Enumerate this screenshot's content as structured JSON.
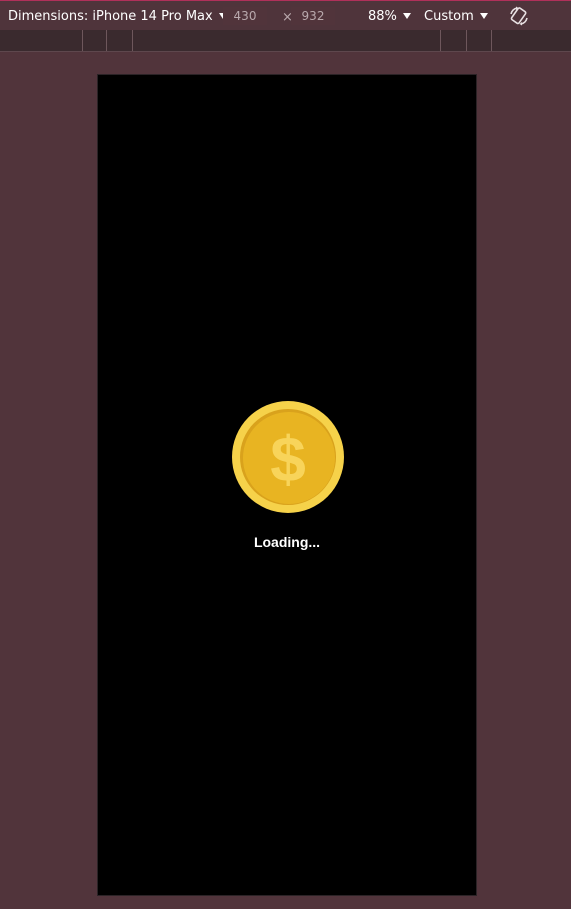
{
  "toolbar": {
    "dimensions_label": "Dimensions: iPhone 14 Pro Max",
    "width_value": "430",
    "times_symbol": "×",
    "height_value": "932",
    "zoom_value": "88%",
    "throttle_value": "Custom",
    "rotate_icon": "rotate-device-icon"
  },
  "screen": {
    "coin_icon": "dollar-coin-icon",
    "loading_text": "Loading..."
  },
  "colors": {
    "page_background": "#51343b",
    "screen_background": "#000000",
    "coin_outer": "#f6d24a",
    "coin_inner": "#e8b422",
    "coin_symbol": "#f8d45a"
  }
}
